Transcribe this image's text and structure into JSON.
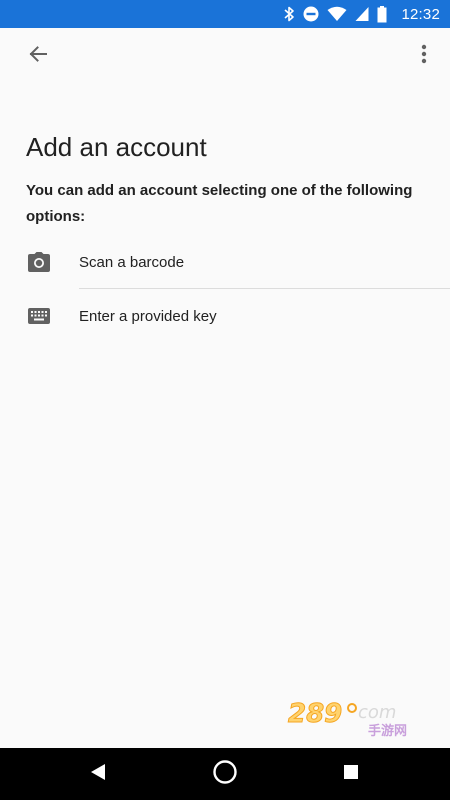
{
  "status_bar": {
    "time": "12:32",
    "icons": [
      "bluetooth-icon",
      "do-not-disturb-icon",
      "wifi-icon",
      "cellular-signal-icon",
      "battery-icon"
    ],
    "background_color": "#1a73d8"
  },
  "toolbar": {
    "back_icon": "arrow-back-icon",
    "overflow_icon": "more-vert-icon"
  },
  "page": {
    "title": "Add an account",
    "subtitle": "You can add an account selecting one of the following options:"
  },
  "options": [
    {
      "label": "Scan a barcode",
      "icon": "camera-icon"
    },
    {
      "label": "Enter a provided key",
      "icon": "keyboard-icon"
    }
  ],
  "watermark": {
    "text": "289.com",
    "subtext": "手游网"
  },
  "nav_bar": {
    "back_icon": "nav-back-icon",
    "home_icon": "nav-home-icon",
    "recents_icon": "nav-recents-icon"
  }
}
